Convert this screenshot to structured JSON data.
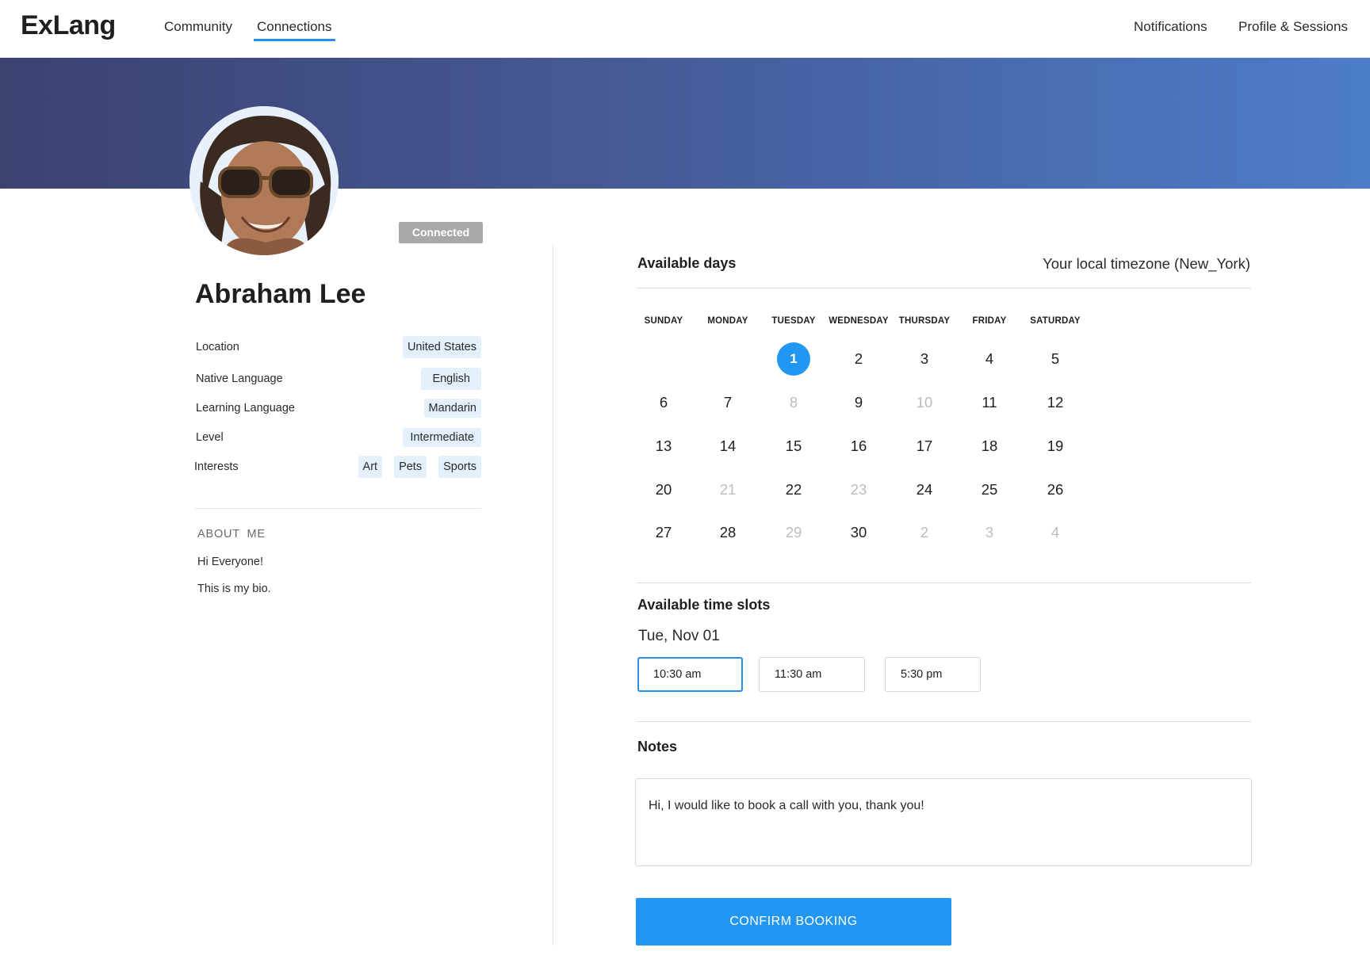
{
  "app": {
    "logo": "ExLang"
  },
  "nav": {
    "left": [
      {
        "label": "Community",
        "active": false
      },
      {
        "label": "Connections",
        "active": true
      }
    ],
    "right": [
      {
        "label": "Notifications"
      },
      {
        "label": "Profile & Sessions"
      }
    ]
  },
  "profile": {
    "name": "Abraham Lee",
    "status": "Connected",
    "attributes": {
      "location": {
        "label": "Location",
        "values": [
          "United States"
        ]
      },
      "native_language": {
        "label": "Native Language",
        "values": [
          "English"
        ]
      },
      "learning_language": {
        "label": "Learning Language",
        "values": [
          "Mandarin"
        ]
      },
      "level": {
        "label": "Level",
        "values": [
          "Intermediate"
        ]
      },
      "interests": {
        "label": "Interests",
        "values": [
          "Art",
          "Pets",
          "Sports"
        ]
      }
    },
    "about": {
      "heading": "ABOUT ME",
      "lines": [
        "Hi Everyone!",
        "This is my bio."
      ]
    }
  },
  "booking": {
    "available_days_title": "Available days",
    "timezone": "Your local timezone (New_York)",
    "weekdays": [
      "SUNDAY",
      "MONDAY",
      "TUESDAY",
      "WEDNESDAY",
      "THURSDAY",
      "FRIDAY",
      "SATURDAY"
    ],
    "calendar_weeks": [
      [
        null,
        null,
        {
          "d": "1",
          "state": "selected"
        },
        {
          "d": "2",
          "state": "available"
        },
        {
          "d": "3",
          "state": "available"
        },
        {
          "d": "4",
          "state": "available"
        },
        {
          "d": "5",
          "state": "available"
        }
      ],
      [
        {
          "d": "6",
          "state": "available"
        },
        {
          "d": "7",
          "state": "available"
        },
        {
          "d": "8",
          "state": "unavailable"
        },
        {
          "d": "9",
          "state": "available"
        },
        {
          "d": "10",
          "state": "unavailable"
        },
        {
          "d": "11",
          "state": "available"
        },
        {
          "d": "12",
          "state": "available"
        }
      ],
      [
        {
          "d": "13",
          "state": "available"
        },
        {
          "d": "14",
          "state": "available"
        },
        {
          "d": "15",
          "state": "available"
        },
        {
          "d": "16",
          "state": "available"
        },
        {
          "d": "17",
          "state": "available"
        },
        {
          "d": "18",
          "state": "available"
        },
        {
          "d": "19",
          "state": "available"
        }
      ],
      [
        {
          "d": "20",
          "state": "available"
        },
        {
          "d": "21",
          "state": "unavailable"
        },
        {
          "d": "22",
          "state": "available"
        },
        {
          "d": "23",
          "state": "unavailable"
        },
        {
          "d": "24",
          "state": "available"
        },
        {
          "d": "25",
          "state": "available"
        },
        {
          "d": "26",
          "state": "available"
        }
      ],
      [
        {
          "d": "27",
          "state": "available"
        },
        {
          "d": "28",
          "state": "available"
        },
        {
          "d": "29",
          "state": "unavailable"
        },
        {
          "d": "30",
          "state": "available"
        },
        {
          "d": "2",
          "state": "unavailable"
        },
        {
          "d": "3",
          "state": "unavailable"
        },
        {
          "d": "4",
          "state": "unavailable"
        }
      ]
    ],
    "time_slots_title": "Available time slots",
    "selected_date": "Tue, Nov 01",
    "time_slots": [
      {
        "label": "10:30 am",
        "selected": true
      },
      {
        "label": "11:30 am",
        "selected": false
      },
      {
        "label": "5:30 pm",
        "selected": false
      }
    ],
    "notes_title": "Notes",
    "notes_value": "Hi, I would like to book a call with you, thank you!",
    "confirm_label": "CONFIRM BOOKING"
  },
  "colors": {
    "accent": "#2196f3",
    "banner_start": "#3c4170",
    "banner_end": "#4c7cc8",
    "chip_bg": "#e3f0fc",
    "status_badge_bg": "#a9a9a9",
    "muted_text": "#bdbdbd"
  }
}
